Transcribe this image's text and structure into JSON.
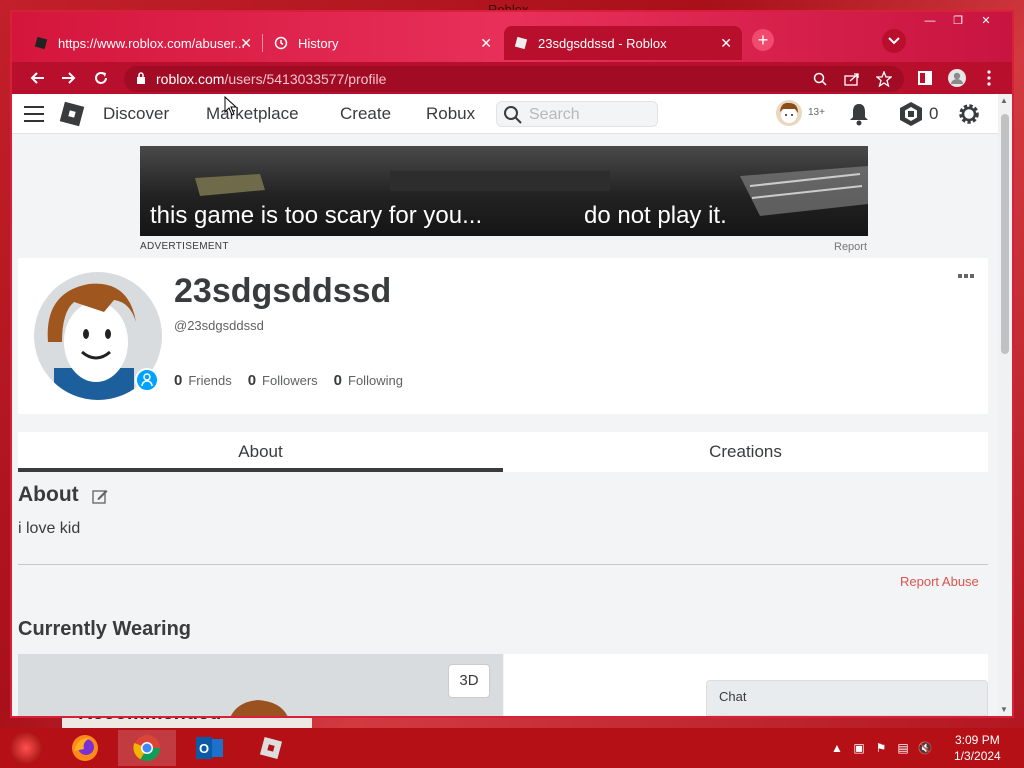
{
  "desktop": {
    "title": "Roblox",
    "behind_text": "Recommended"
  },
  "browser": {
    "tabs": [
      {
        "title": "https://www.roblox.com/abuser..."
      },
      {
        "title": "History"
      },
      {
        "title": "23sdgsddssd - Roblox"
      }
    ],
    "url_domain": "roblox.com",
    "url_path": "/users/5413033577/profile"
  },
  "nav": {
    "links": [
      "Discover",
      "Marketplace",
      "Create",
      "Robux"
    ],
    "search_placeholder": "Search",
    "age": "13+",
    "robux": "0"
  },
  "ad": {
    "text_left": "this game is too scary for you...",
    "text_right": "do not play it.",
    "label": "ADVERTISEMENT",
    "report": "Report"
  },
  "profile": {
    "display_name": "23sdgsddssd",
    "handle": "@23sdgsddssd",
    "friends": {
      "count": "0",
      "label": "Friends"
    },
    "followers": {
      "count": "0",
      "label": "Followers"
    },
    "following": {
      "count": "0",
      "label": "Following"
    }
  },
  "tabs": {
    "about": "About",
    "creations": "Creations"
  },
  "about": {
    "heading": "About",
    "text": "i love kid",
    "report_abuse": "Report Abuse"
  },
  "wearing": {
    "heading": "Currently Wearing",
    "btn_3d": "3D"
  },
  "chat": {
    "label": "Chat"
  },
  "taskbar": {
    "time": "3:09 PM",
    "date": "1/3/2024"
  }
}
